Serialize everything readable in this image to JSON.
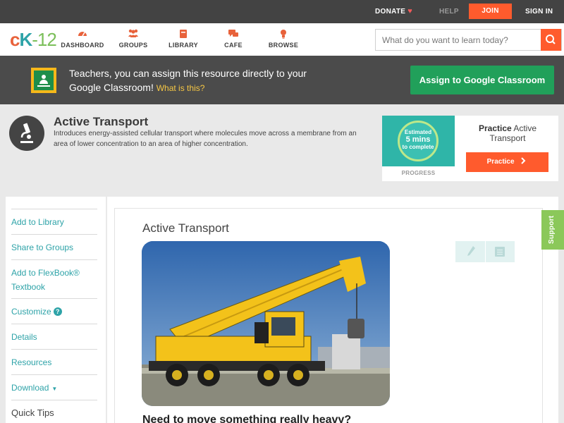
{
  "topbar": {
    "donate": "DONATE",
    "help": "HELP",
    "join": "JOIN",
    "signin": "SIGN IN"
  },
  "logo": {
    "c": "c",
    "k": "K",
    "n": "12"
  },
  "nav": {
    "items": [
      {
        "label": "DASHBOARD",
        "icon": "dashboard-icon"
      },
      {
        "label": "GROUPS",
        "icon": "groups-icon"
      },
      {
        "label": "LIBRARY",
        "icon": "library-icon"
      },
      {
        "label": "CAFE",
        "icon": "cafe-icon"
      },
      {
        "label": "BROWSE",
        "icon": "browse-icon"
      }
    ],
    "search_placeholder": "What do you want to learn today?"
  },
  "banner": {
    "text": "Teachers, you can assign this resource directly to your Google Classroom!",
    "whatis": "What is this?",
    "assign_label": "Assign to Google Classroom"
  },
  "concept": {
    "title": "Active Transport",
    "description": "Introduces energy-assisted cellular transport where molecules move across a membrane from an area of lower concentration to an area of higher concentration."
  },
  "practice": {
    "estimated": "Estimated",
    "mins": "5 mins",
    "to_complete": "to complete",
    "progress_label": "PROGRESS",
    "title_bold": "Practice",
    "title_rest": "Active Transport",
    "button_label": "Practice"
  },
  "sidebar": {
    "items": [
      {
        "label": "Add to Library"
      },
      {
        "label": "Share to Groups"
      },
      {
        "label": "Add to FlexBook® Textbook"
      },
      {
        "label": "Customize"
      },
      {
        "label": "Details"
      },
      {
        "label": "Resources"
      },
      {
        "label": "Download"
      },
      {
        "label": "Quick Tips"
      }
    ]
  },
  "content": {
    "title": "Active Transport",
    "next_heading": "Need to move something really heavy?"
  },
  "support": {
    "label": "Support"
  },
  "colors": {
    "accent": "#ff5b2d",
    "teal": "#2ea3a8",
    "green": "#21a05a"
  }
}
